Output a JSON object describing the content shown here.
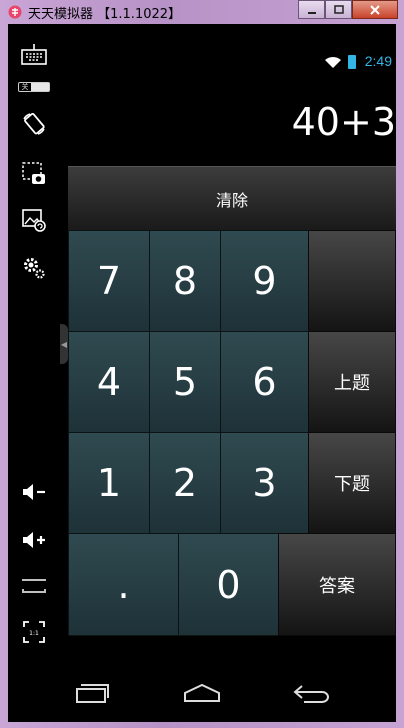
{
  "window": {
    "title": "天天模拟器 【1.1.1022】"
  },
  "sidebar": {
    "toggle_label": "关",
    "ratio_label": "1:1"
  },
  "status": {
    "time": "2:49"
  },
  "display": {
    "expression": "40+3"
  },
  "keypad": {
    "clear_label": "清除",
    "digits": [
      "7",
      "8",
      "9",
      "4",
      "5",
      "6",
      "1",
      "2",
      "3"
    ],
    "dot": ".",
    "zero": "0",
    "prev_label": "上题",
    "next_label": "下题",
    "answer_label": "答案"
  },
  "colors": {
    "accent": "#33b5e5",
    "key_bg": "#2a4248",
    "side_key_bg": "#2e2e2e"
  }
}
